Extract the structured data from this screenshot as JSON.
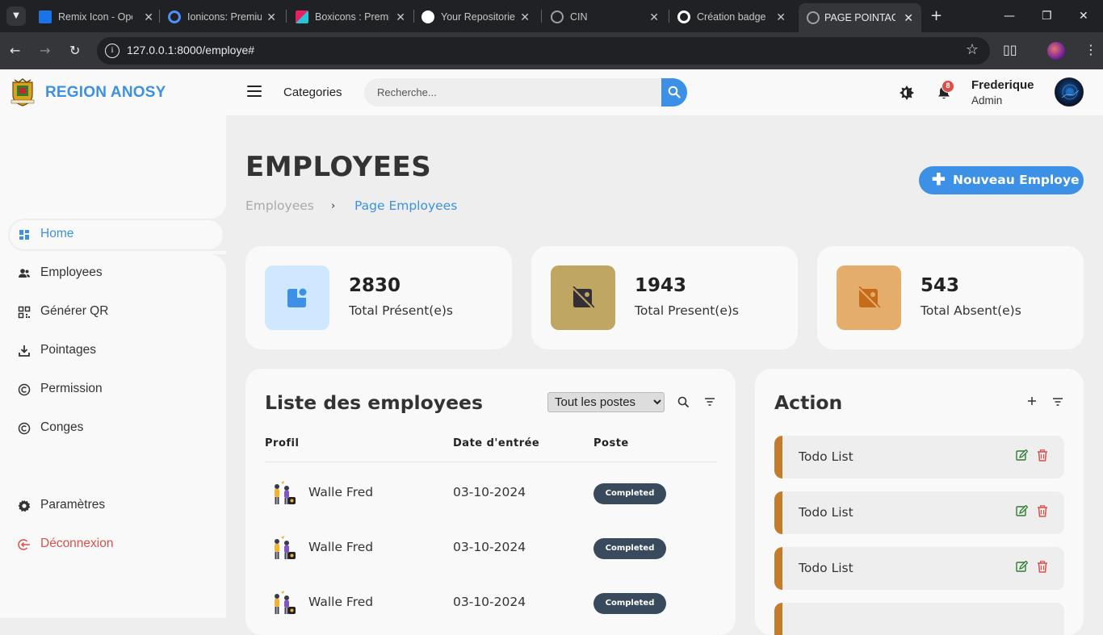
{
  "browser": {
    "tabs": [
      {
        "title": "Remix Icon - Open",
        "favicon_color": "#1a73e8"
      },
      {
        "title": "Ionicons: Premium",
        "favicon_color": "#4f8ef7"
      },
      {
        "title": "Boxicons : Premium",
        "favicon_color": "#e91e63"
      },
      {
        "title": "Your Repositories",
        "favicon_color": "#ffffff"
      },
      {
        "title": "CIN",
        "favicon_color": "#9aa0a6"
      },
      {
        "title": "Création badge",
        "favicon_color": "#ffffff"
      },
      {
        "title": "PAGE POINTAGE",
        "favicon_color": "#9aa0a6",
        "active": true
      }
    ],
    "url": "127.0.0.1:8000/employe#"
  },
  "header": {
    "brand": "REGION ANOSY",
    "categories_label": "Categories",
    "search_placeholder": "Recherche...",
    "notification_count": "8",
    "user_name": "Frederique",
    "user_role": "Admin"
  },
  "sidebar": {
    "items": [
      {
        "label": "Home",
        "icon": "dashboard-icon",
        "active": true
      },
      {
        "label": "Employees",
        "icon": "users-icon"
      },
      {
        "label": "Générer QR",
        "icon": "qr-code-icon"
      },
      {
        "label": "Pointages",
        "icon": "download-icon"
      },
      {
        "label": "Permission",
        "icon": "copyright-icon"
      },
      {
        "label": "Conges",
        "icon": "copyright-icon"
      }
    ],
    "settings_label": "Paramètres",
    "logout_label": "Déconnexion"
  },
  "main": {
    "title": "EMPLOYEES",
    "breadcrumb": [
      "Employees",
      "Page Employees"
    ],
    "breadcrumb_separator": "›",
    "new_button_label": "Nouveau Employe",
    "stats": [
      {
        "value": "2830",
        "label": "Total Présent(e)s",
        "color": "#cfe8ff",
        "icon_color": "#3c91e6"
      },
      {
        "value": "1943",
        "label": "Total Present(e)s",
        "color": "#bfa663",
        "icon_color": "#342e37"
      },
      {
        "value": "543",
        "label": "Total Absent(e)s",
        "color": "#e5ad6b",
        "icon_color": "#c56b1a"
      }
    ]
  },
  "employees_panel": {
    "title": "Liste des employees",
    "filter_value": "Tout les postes",
    "columns": [
      "Profil",
      "Date d'entrée",
      "Poste"
    ],
    "rows": [
      {
        "name": "Walle Fred",
        "date": "03-10-2024",
        "status": "Completed"
      },
      {
        "name": "Walle Fred",
        "date": "03-10-2024",
        "status": "Completed"
      },
      {
        "name": "Walle Fred",
        "date": "03-10-2024",
        "status": "Completed"
      }
    ]
  },
  "action_panel": {
    "title": "Action",
    "todos": [
      {
        "label": "Todo List"
      },
      {
        "label": "Todo List"
      },
      {
        "label": "Todo List"
      }
    ]
  },
  "colors": {
    "accent": "#3c91e6",
    "danger": "#db504a",
    "todo_border": "#c47b2a"
  }
}
